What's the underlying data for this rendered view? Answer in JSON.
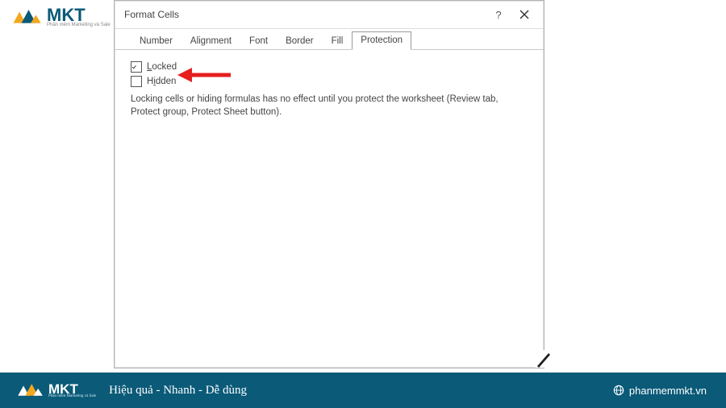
{
  "logo": {
    "letters": "MKT"
  },
  "dialog": {
    "title": "Format Cells",
    "tabs": [
      "Number",
      "Alignment",
      "Font",
      "Border",
      "Fill",
      "Protection"
    ],
    "active_tab_index": 5,
    "locked_label": "Locked",
    "hidden_label": "Hidden",
    "locked_checked": true,
    "hidden_checked": false,
    "description": "Locking cells or hiding formulas has no effect until you protect the worksheet (Review tab, Protect group, Protect Sheet button)."
  },
  "footer": {
    "tagline": "Hiệu quả - Nhanh  - Dễ dùng",
    "site": "phanmemmkt.vn"
  }
}
